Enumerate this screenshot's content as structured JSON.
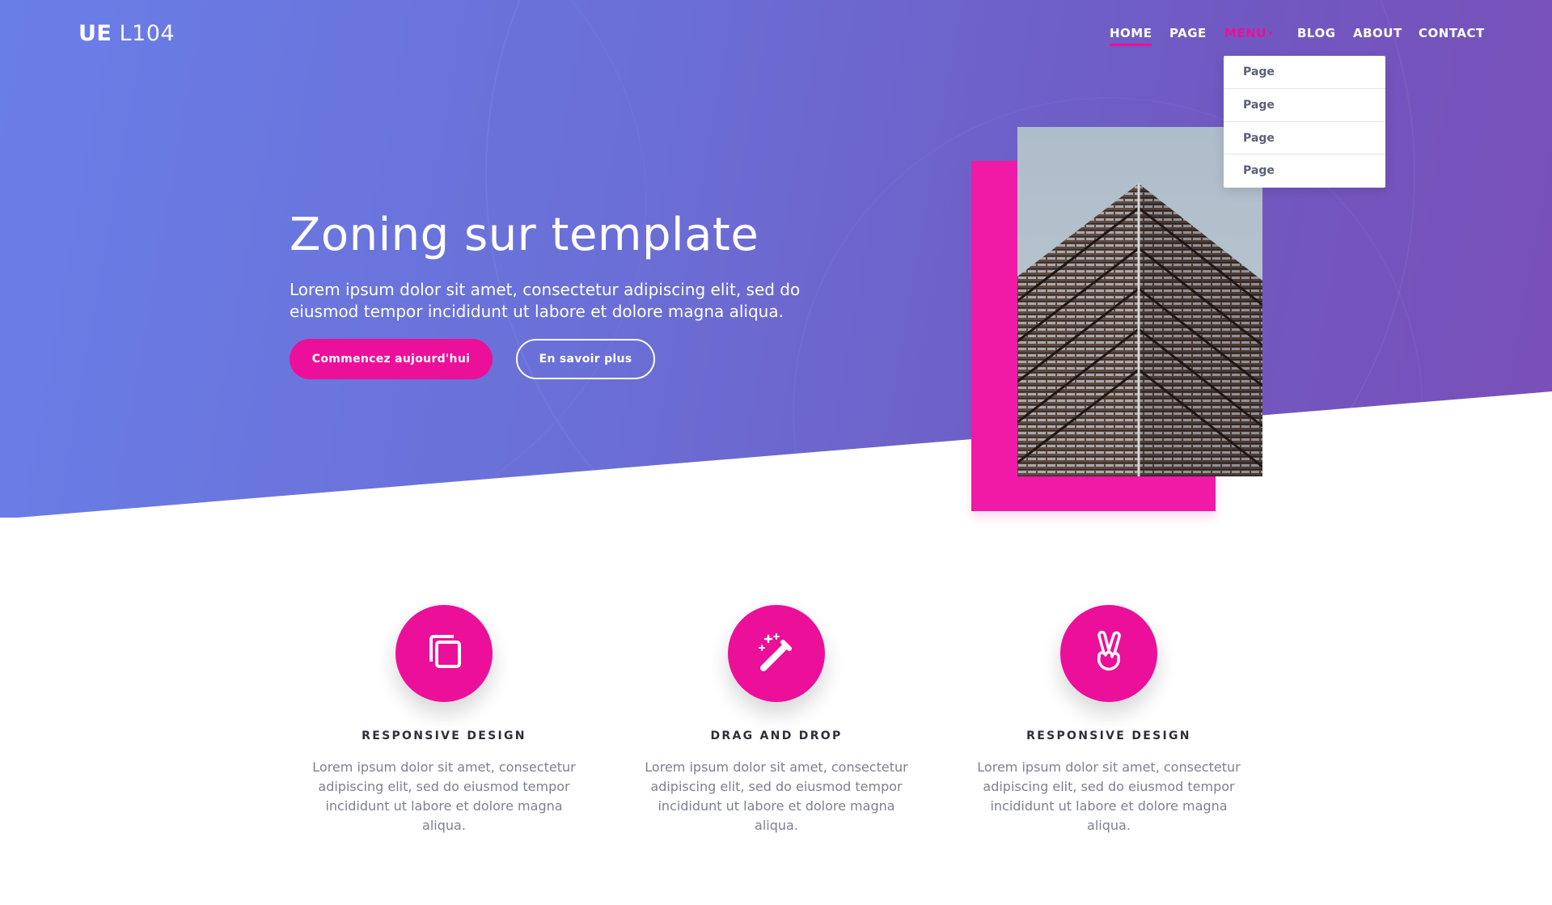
{
  "brand": {
    "bold": "UE",
    "light": "L104"
  },
  "nav": {
    "items": [
      {
        "label": "HOME"
      },
      {
        "label": "PAGE"
      },
      {
        "label": "MENU"
      },
      {
        "label": "BLOG"
      },
      {
        "label": "ABOUT"
      },
      {
        "label": "CONTACT"
      }
    ],
    "dropdown": [
      "Page",
      "Page",
      "Page",
      "Page"
    ]
  },
  "hero": {
    "title": "Zoning sur template",
    "subtitle": "Lorem ipsum dolor sit amet, consectetur adipiscing elit, sed do eiusmod tempor incididunt ut labore et dolore magna aliqua.",
    "primary_button": "Commencez aujourd'hui",
    "secondary_button": "En savoir plus"
  },
  "features": [
    {
      "icon": "copy-icon",
      "title": "RESPONSIVE DESIGN",
      "text": "Lorem ipsum dolor sit amet, consectetur adipiscing elit, sed do eiusmod tempor incididunt ut labore et dolore magna aliqua."
    },
    {
      "icon": "magic-wand-icon",
      "title": "DRAG AND DROP",
      "text": "Lorem ipsum dolor sit amet, consectetur adipiscing elit, sed do eiusmod tempor incididunt ut labore et dolore magna aliqua."
    },
    {
      "icon": "peace-hand-icon",
      "title": "RESPONSIVE DESIGN",
      "text": "Lorem ipsum dolor sit amet, consectetur adipiscing elit, sed do eiusmod tempor incididunt ut labore et dolore magna aliqua."
    }
  ],
  "colors": {
    "accent": "#ec0f9a",
    "hero_gradient_start": "#6a7ee8",
    "hero_gradient_end": "#7a4fb8",
    "heading": "#2f2f3a",
    "body_text": "#7d8190"
  }
}
